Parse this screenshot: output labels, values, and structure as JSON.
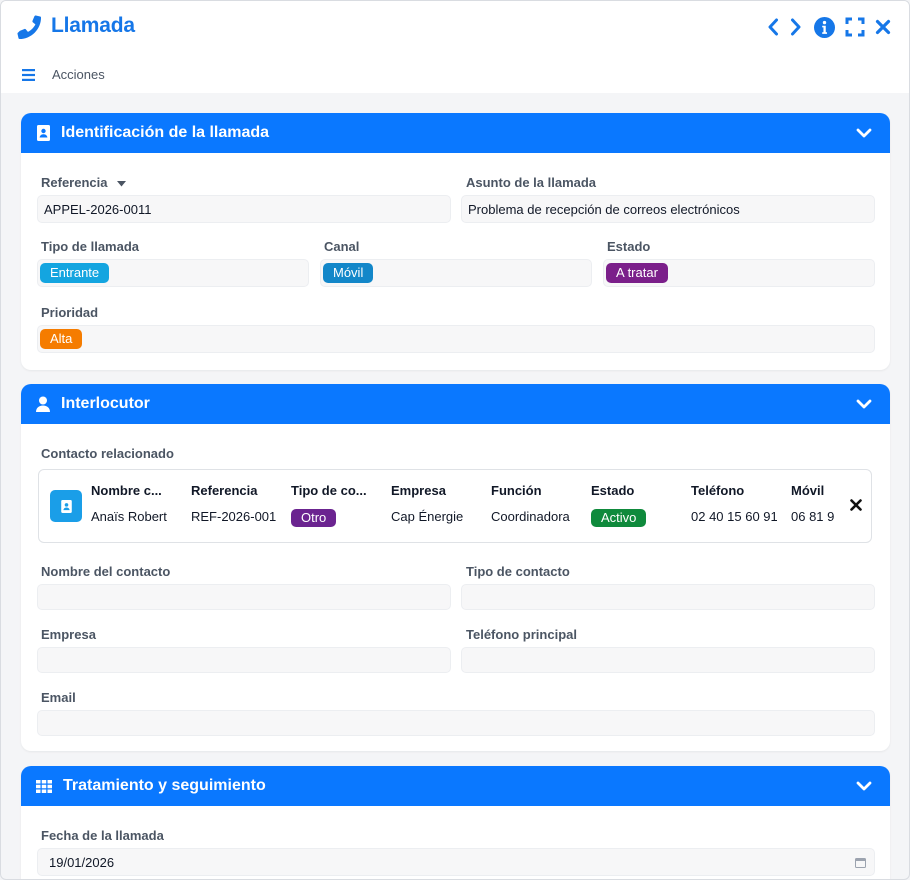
{
  "window": {
    "title": "Llamada",
    "menu_label": "Acciones"
  },
  "colors": {
    "brand": "#1677e8",
    "header": "#0a78ff",
    "entrante": "#14a5e0",
    "movil": "#1387c9",
    "a_tratar": "#7b1f8a",
    "alta": "#f57c00",
    "otro": "#6b2490",
    "activo": "#0f8a3c"
  },
  "identificacion": {
    "title": "Identificación de la llamada",
    "referencia_label": "Referencia",
    "referencia_value": "APPEL-2026-0011",
    "asunto_label": "Asunto de la llamada",
    "asunto_value": "Problema de recepción de correos electrónicos",
    "tipo_label": "Tipo de llamada",
    "tipo_value": "Entrante",
    "canal_label": "Canal",
    "canal_value": "Móvil",
    "estado_label": "Estado",
    "estado_value": "A tratar",
    "prioridad_label": "Prioridad",
    "prioridad_value": "Alta"
  },
  "interlocutor": {
    "title": "Interlocutor",
    "contacto_label": "Contacto relacionado",
    "contact": {
      "headers": [
        "Nombre c...",
        "Referencia",
        "Tipo de co...",
        "Empresa",
        "Función",
        "Estado",
        "Teléfono",
        "Móvil"
      ],
      "values": [
        "Anaïs Robert",
        "REF-2026-001",
        "Otro",
        "Cap Énergie",
        "Coordinadora",
        "Activo",
        "02 40 15 60 91",
        "06 81 9"
      ]
    },
    "nombre_label": "Nombre del contacto",
    "nombre_value": "",
    "tipo_contacto_label": "Tipo de contacto",
    "tipo_contacto_value": "",
    "empresa_label": "Empresa",
    "empresa_value": "",
    "telefono_label": "Teléfono principal",
    "telefono_value": "",
    "email_label": "Email",
    "email_value": ""
  },
  "tratamiento": {
    "title": "Tratamiento y seguimiento",
    "fecha_label": "Fecha de la llamada",
    "fecha_value": "19/01/2026"
  }
}
